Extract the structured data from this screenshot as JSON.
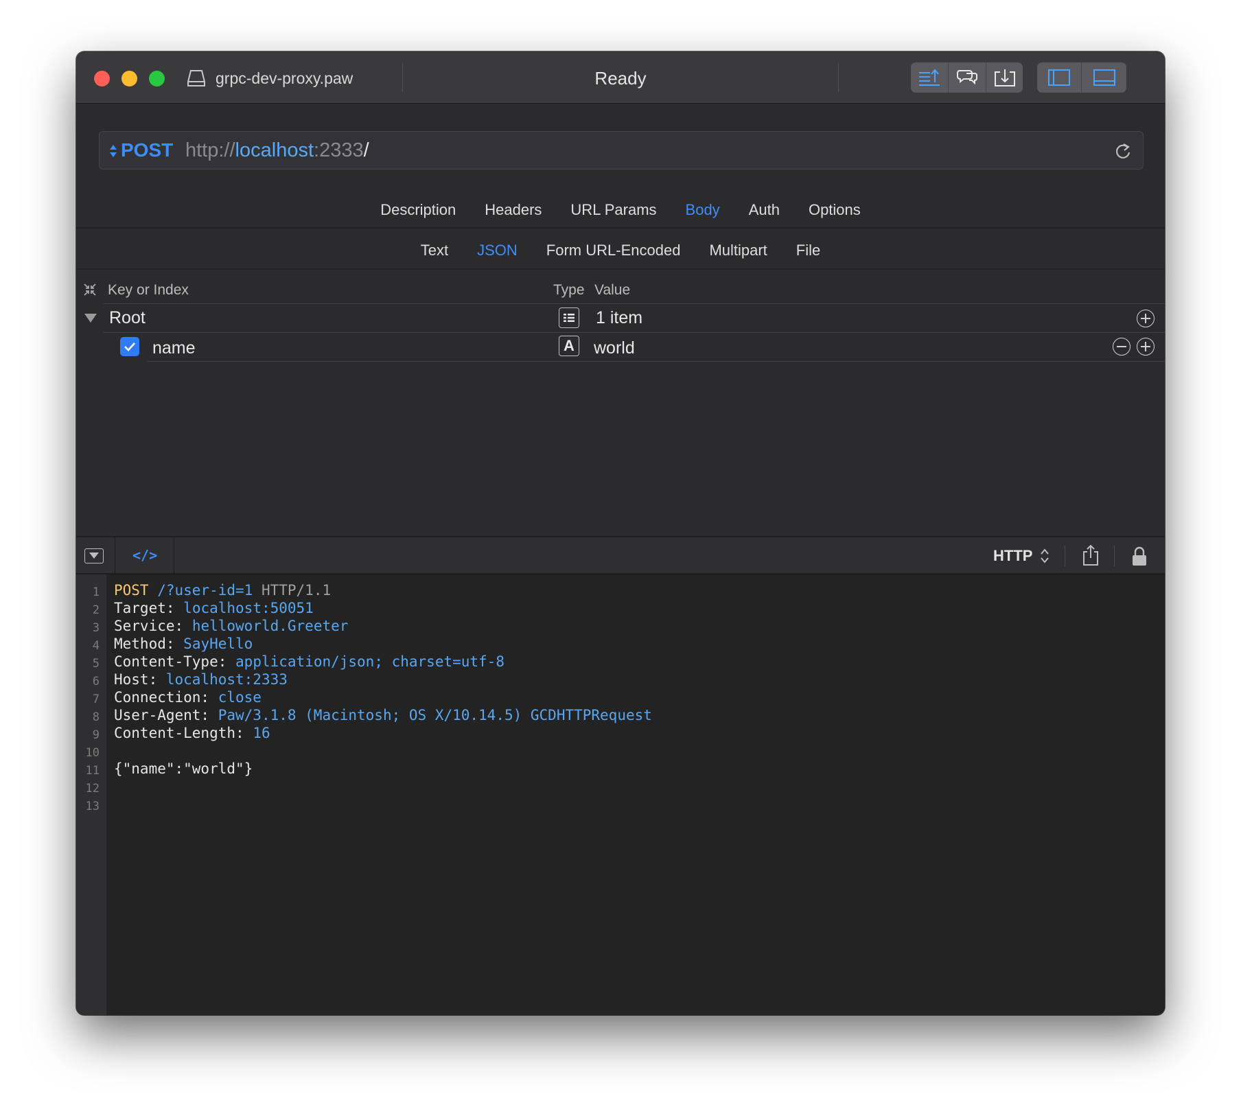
{
  "window": {
    "document_title": "grpc-dev-proxy.paw",
    "status": "Ready"
  },
  "request": {
    "method": "POST",
    "url_scheme": "http://",
    "url_host": "localhost",
    "url_port": ":2333",
    "url_path": "/"
  },
  "tabs": [
    {
      "label": "Description",
      "active": false
    },
    {
      "label": "Headers",
      "active": false
    },
    {
      "label": "URL Params",
      "active": false
    },
    {
      "label": "Body",
      "active": true
    },
    {
      "label": "Auth",
      "active": false
    },
    {
      "label": "Options",
      "active": false
    }
  ],
  "body_tabs": [
    {
      "label": "Text",
      "active": false
    },
    {
      "label": "JSON",
      "active": true
    },
    {
      "label": "Form URL-Encoded",
      "active": false
    },
    {
      "label": "Multipart",
      "active": false
    },
    {
      "label": "File",
      "active": false
    }
  ],
  "json_editor": {
    "header_key": "Key or Index",
    "header_type": "Type",
    "header_value": "Value",
    "root_key": "Root",
    "root_value": "1 item",
    "rows": [
      {
        "key": "name",
        "type_glyph": "A",
        "value": "world",
        "enabled": true
      }
    ]
  },
  "code_toolbar": {
    "code_icon": "</>",
    "format": "HTTP"
  },
  "code": {
    "line_numbers": [
      "1",
      "2",
      "3",
      "4",
      "5",
      "6",
      "7",
      "8",
      "9",
      "10",
      "11",
      "12",
      "13"
    ],
    "request_line": {
      "method": "POST",
      "path": "/?user-id=1",
      "protocol": "HTTP/1.1"
    },
    "headers": [
      {
        "key": "Target:",
        "value": "localhost:50051"
      },
      {
        "key": "Service:",
        "value": "helloworld.Greeter"
      },
      {
        "key": "Method:",
        "value": "SayHello"
      },
      {
        "key": "Content-Type:",
        "value": "application/json; charset=utf-8"
      },
      {
        "key": "Host:",
        "value": "localhost:2333"
      },
      {
        "key": "Connection:",
        "value": "close"
      },
      {
        "key": "User-Agent:",
        "value": "Paw/3.1.8 (Macintosh; OS X/10.14.5) GCDHTTPRequest"
      },
      {
        "key": "Content-Length:",
        "value": "16"
      }
    ],
    "body": "{\"name\":\"world\"}"
  },
  "colors": {
    "accent": "#3d8ef8",
    "code_value": "#59a7f0",
    "code_method": "#f7c873"
  }
}
